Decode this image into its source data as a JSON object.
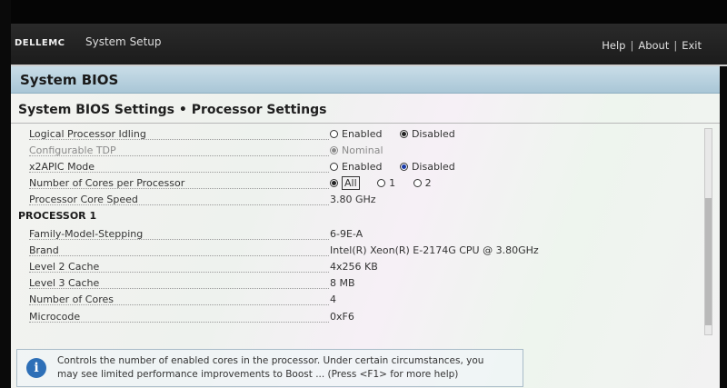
{
  "header": {
    "logo": "DELLEMC",
    "app_title": "System Setup",
    "links": [
      "Help",
      "About",
      "Exit"
    ]
  },
  "page": {
    "section_title": "System BIOS",
    "breadcrumb": "System BIOS Settings • Processor Settings"
  },
  "settings": [
    {
      "label": "Logical Processor Idling",
      "options": [
        "Enabled",
        "Disabled"
      ],
      "selected": "Disabled"
    },
    {
      "label": "Configurable TDP",
      "options": [
        "Nominal"
      ],
      "selected": "Nominal",
      "disabled": true
    },
    {
      "label": "x2APIC Mode",
      "options": [
        "Enabled",
        "Disabled"
      ],
      "selected": "Disabled"
    },
    {
      "label": "Number of Cores per Processor",
      "options": [
        "All",
        "1",
        "2"
      ],
      "selected": "All"
    },
    {
      "label": "Processor Core Speed",
      "value": "3.80 GHz"
    }
  ],
  "processor": {
    "heading": "PROCESSOR 1",
    "rows": [
      {
        "label": "Family-Model-Stepping",
        "value": "6-9E-A"
      },
      {
        "label": "Brand",
        "value": "Intel(R) Xeon(R) E-2174G CPU @ 3.80GHz"
      },
      {
        "label": "Level 2 Cache",
        "value": "4x256 KB"
      },
      {
        "label": "Level 3 Cache",
        "value": "8 MB"
      },
      {
        "label": "Number of Cores",
        "value": "4"
      },
      {
        "label": "Microcode",
        "value": "0xF6"
      }
    ]
  },
  "help": {
    "icon": "info-icon",
    "line1": "Controls the number of enabled cores in the processor. Under certain circumstances, you",
    "line2": "may see limited performance improvements to Boost ... (Press <F1> for more help)"
  },
  "colors": {
    "header_bg": "#1c1c1c",
    "bios_bar": "#b5cfdd",
    "info_blue": "#2d6fb7",
    "radio_selected": "#1a3aa8"
  }
}
